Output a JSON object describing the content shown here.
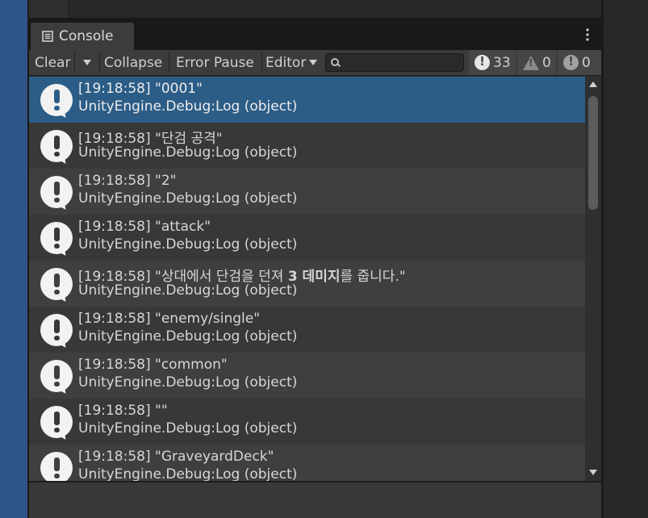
{
  "window": {
    "tab_title": "Console",
    "more_menu_icon": "vertical-ellipsis-icon"
  },
  "toolbar": {
    "clear_label": "Clear",
    "collapse_label": "Collapse",
    "error_pause_label": "Error Pause",
    "editor_label": "Editor",
    "search_placeholder": "",
    "log_count": "33",
    "warning_count": "0",
    "error_count": "0"
  },
  "logs": [
    {
      "line1": "[19:18:58] \"0001\"",
      "line2": "UnityEngine.Debug:Log (object)",
      "selected": true
    },
    {
      "line1": "[19:18:58] \"단검 공격\"",
      "line2": "UnityEngine.Debug:Log (object)"
    },
    {
      "line1": "[19:18:58] \"2\"",
      "line2": "UnityEngine.Debug:Log (object)"
    },
    {
      "line1": "[19:18:58] \"attack\"",
      "line2": "UnityEngine.Debug:Log (object)"
    },
    {
      "line1_pre": "[19:18:58] \"상대에서 단검을 던져 ",
      "line1_bold": "3 데미지",
      "line1_post": "를 줍니다.\"",
      "line2": "UnityEngine.Debug:Log (object)"
    },
    {
      "line1": "[19:18:58] \"enemy/single\"",
      "line2": "UnityEngine.Debug:Log (object)"
    },
    {
      "line1": "[19:18:58] \"common\"",
      "line2": "UnityEngine.Debug:Log (object)"
    },
    {
      "line1": "[19:18:58] \"\"",
      "line2": "UnityEngine.Debug:Log (object)"
    },
    {
      "line1": "[19:18:58] \"GraveyardDeck\"",
      "line2": "UnityEngine.Debug:Log (object)"
    }
  ],
  "colors": {
    "selection": "#2c5d87",
    "panel": "#3c3c3c",
    "side_strip": "#2f5489"
  }
}
